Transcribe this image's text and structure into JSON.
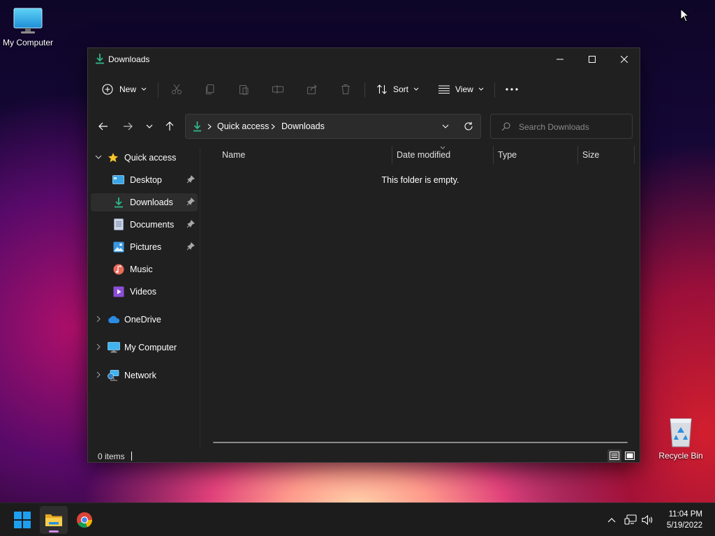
{
  "desktop": {
    "icons": [
      {
        "label": "My Computer",
        "icon": "monitor-icon"
      },
      {
        "label": "Recycle Bin",
        "icon": "recycle-bin-icon"
      }
    ]
  },
  "window": {
    "title": "Downloads",
    "title_icon": "download-arrow-icon",
    "controls": [
      "minimize-icon",
      "maximize-icon",
      "close-icon"
    ],
    "accent_color": "#2fb88b"
  },
  "commandbar": {
    "new_label": "New",
    "sort_label": "Sort",
    "view_label": "View",
    "disabled_actions": [
      "cut-icon",
      "copy-icon",
      "paste-icon",
      "rename-icon",
      "share-icon",
      "delete-icon"
    ],
    "more_icon": "more-icon"
  },
  "navigation": {
    "buttons": [
      "back-arrow-icon",
      "forward-arrow-icon",
      "recent-chevron-icon",
      "up-arrow-icon"
    ]
  },
  "address": {
    "segments": [
      "Quick access",
      "Downloads"
    ]
  },
  "search": {
    "placeholder": "Search Downloads",
    "value": ""
  },
  "sidebar": {
    "items": [
      {
        "label": "Quick access",
        "icon": "star-icon",
        "expanded": true
      },
      {
        "label": "Desktop",
        "icon": "desktop-folder-icon",
        "pinned": true
      },
      {
        "label": "Downloads",
        "icon": "download-arrow-icon",
        "pinned": true,
        "selected": true
      },
      {
        "label": "Documents",
        "icon": "document-icon",
        "pinned": true
      },
      {
        "label": "Pictures",
        "icon": "pictures-icon",
        "pinned": true
      },
      {
        "label": "Music",
        "icon": "music-icon"
      },
      {
        "label": "Videos",
        "icon": "videos-icon"
      },
      {
        "label": "OneDrive",
        "icon": "cloud-icon",
        "expanded": false
      },
      {
        "label": "My Computer",
        "icon": "monitor-icon",
        "expanded": false
      },
      {
        "label": "Network",
        "icon": "network-icon",
        "expanded": false
      }
    ]
  },
  "content": {
    "columns": [
      "Name",
      "Date modified",
      "Type",
      "Size"
    ],
    "empty_message": "This folder is empty."
  },
  "status": {
    "items_text": "0 items",
    "layout_buttons": [
      "details-view-icon",
      "tiles-view-icon"
    ]
  },
  "taskbar": {
    "apps": [
      {
        "name": "start",
        "icon": "windows-logo-icon"
      },
      {
        "name": "file-explorer",
        "icon": "folder-icon",
        "active": true
      },
      {
        "name": "chrome",
        "icon": "chrome-icon"
      }
    ],
    "tray": [
      "chevron-up-icon",
      "network-status-icon",
      "volume-icon"
    ],
    "time": "11:04 PM",
    "date": "5/19/2022"
  }
}
